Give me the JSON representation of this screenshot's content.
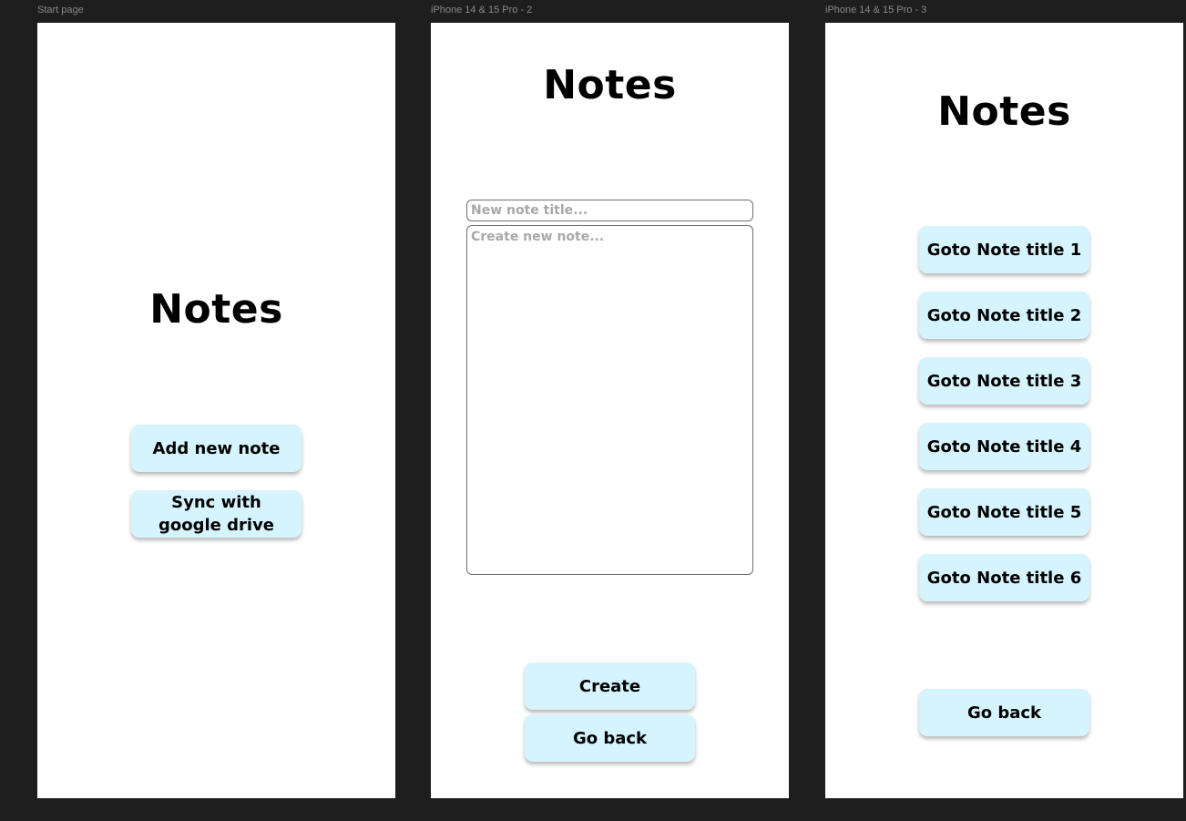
{
  "frames": {
    "start": {
      "label": "Start page",
      "title": "Notes",
      "add_button": "Add new note",
      "sync_button": "Sync with\ngoogle drive"
    },
    "create": {
      "label": "iPhone 14 & 15 Pro - 2",
      "title": "Notes",
      "title_placeholder": "New note title...",
      "body_placeholder": "Create new note...",
      "create_button": "Create",
      "back_button": "Go back"
    },
    "list": {
      "label": "iPhone 14 & 15 Pro - 3",
      "title": "Notes",
      "note_buttons": [
        "Goto Note title 1",
        "Goto Note title 2",
        "Goto Note title 3",
        "Goto Note title 4",
        "Goto Note title 5",
        "Goto Note title 6"
      ],
      "back_button": "Go back"
    }
  },
  "colors": {
    "canvas_bg": "#1e1e1e",
    "frame_bg": "#ffffff",
    "button_bg": "#d5f4fd",
    "placeholder": "#a8a8a8"
  }
}
